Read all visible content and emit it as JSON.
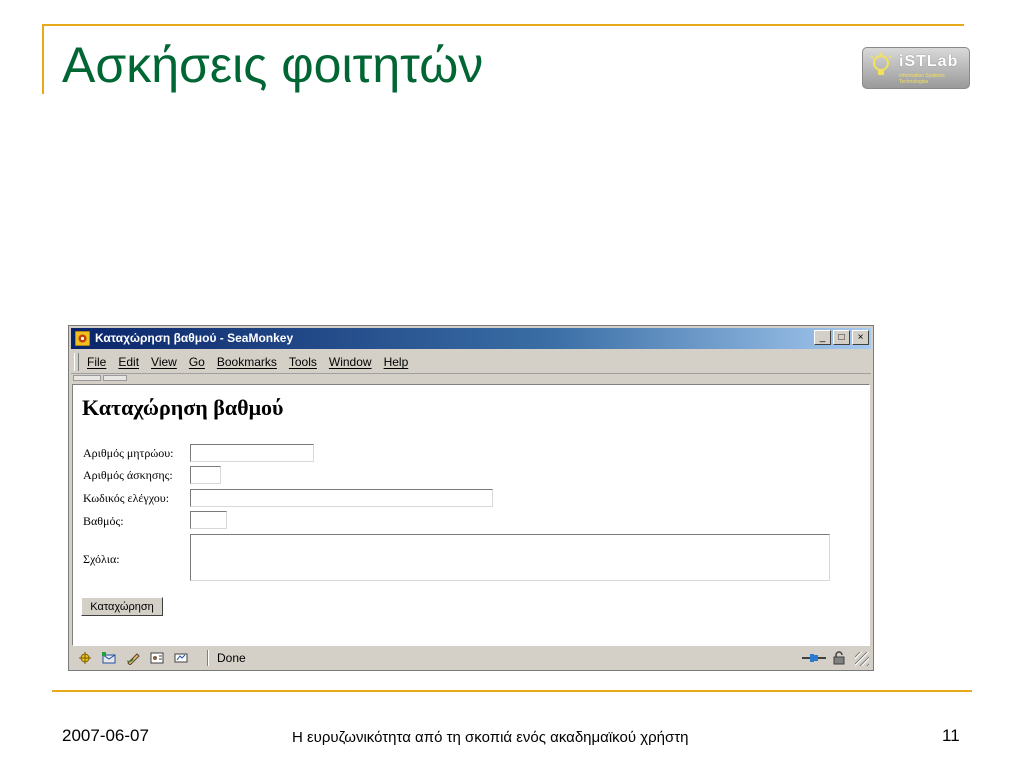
{
  "slide": {
    "title": "Ασκήσεις φοιτητών",
    "logo_text": "iSTLab",
    "logo_subtext": "Information Systems Technologies",
    "accent_color": "#e6a91a",
    "title_color": "#006633"
  },
  "browser": {
    "window_title": "Καταχώρηση βαθμού - SeaMonkey",
    "window_buttons": {
      "minimize": "_",
      "maximize": "□",
      "close": "×"
    },
    "menu": [
      "File",
      "Edit",
      "View",
      "Go",
      "Bookmarks",
      "Tools",
      "Window",
      "Help"
    ],
    "status_text": "Done",
    "titlebar_color": "#0a246a"
  },
  "page": {
    "heading": "Καταχώρηση βαθμού",
    "fields": {
      "student_id_label": "Αριθμός μητρώου:",
      "student_id_value": "",
      "exercise_label": "Αριθμός άσκησης:",
      "exercise_value": "",
      "code_label": "Κωδικός ελέγχου:",
      "code_value": "",
      "grade_label": "Βαθμός:",
      "grade_value": "",
      "comments_label": "Σχόλια:",
      "comments_value": ""
    },
    "submit_label": "Καταχώρηση"
  },
  "footer": {
    "date": "2007-06-07",
    "subtitle": "Η ευρυζωνικότητα από τη σκοπιά ενός ακαδημαϊκού χρήστη",
    "page_number": "11"
  }
}
